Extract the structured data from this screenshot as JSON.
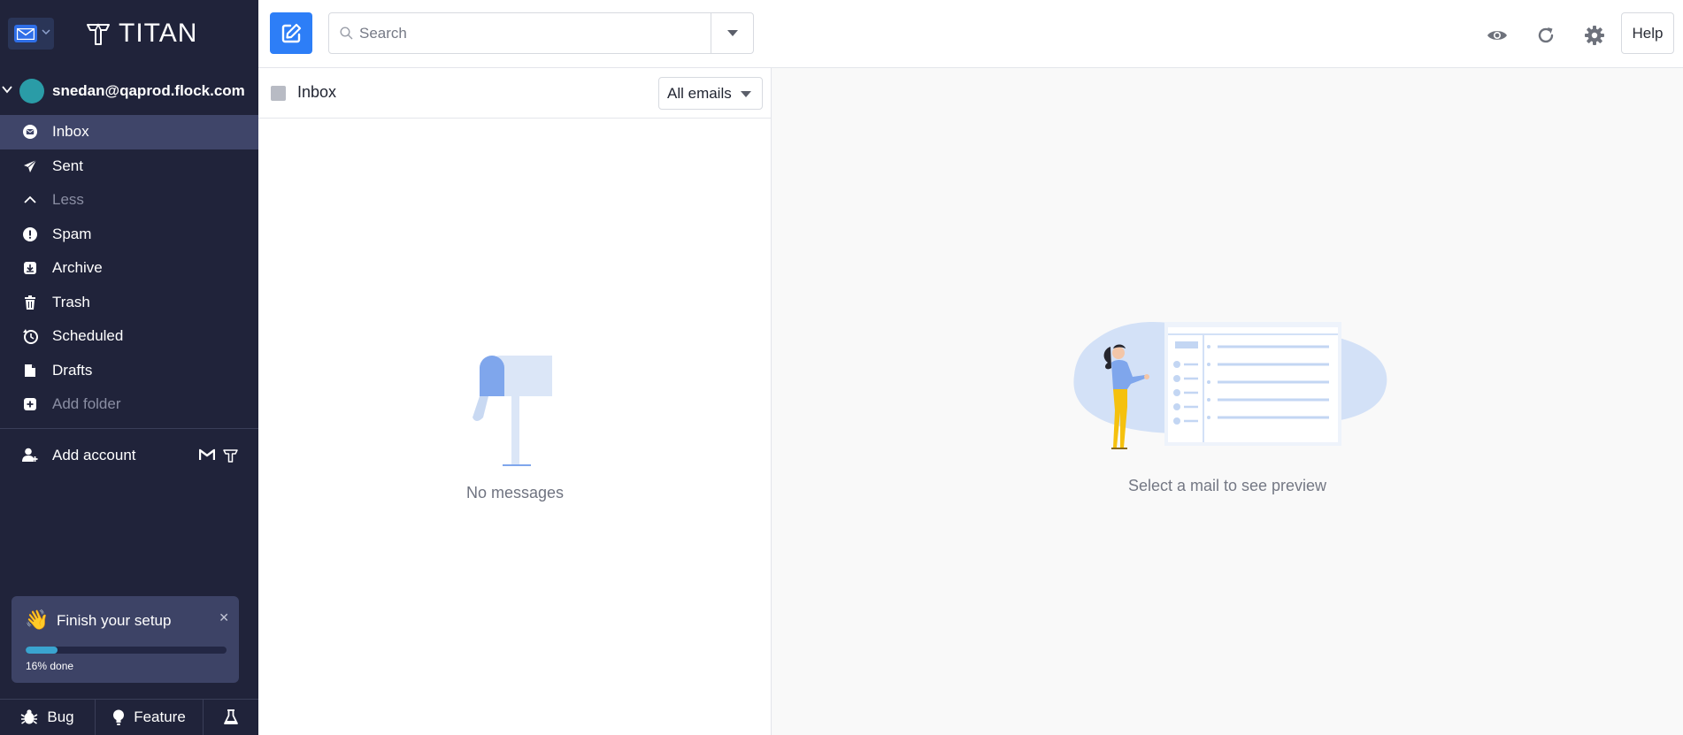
{
  "brand": {
    "logo_text": "TITAN"
  },
  "account": {
    "email": "snedan@qaprod.flock.com"
  },
  "nav": {
    "items": [
      {
        "label": "Inbox",
        "icon": "inbox-icon",
        "active": true
      },
      {
        "label": "Sent",
        "icon": "send-icon"
      },
      {
        "label": "Less",
        "icon": "chevron-up-icon",
        "muted": true
      },
      {
        "label": "Spam",
        "icon": "alert-icon"
      },
      {
        "label": "Archive",
        "icon": "archive-icon"
      },
      {
        "label": "Trash",
        "icon": "trash-icon"
      },
      {
        "label": "Scheduled",
        "icon": "scheduled-icon"
      },
      {
        "label": "Drafts",
        "icon": "drafts-icon"
      },
      {
        "label": "Add folder",
        "icon": "add-folder-icon",
        "muted": true
      }
    ]
  },
  "add_account": {
    "label": "Add account"
  },
  "setup": {
    "title": "Finish your setup",
    "progress_label": "16% done",
    "progress_fraction": 0.16
  },
  "bottom": {
    "bug_label": "Bug",
    "feature_label": "Feature"
  },
  "toolbar": {
    "search_placeholder": "Search",
    "help_label": "Help"
  },
  "list": {
    "folder_name": "Inbox",
    "filter_label": "All emails",
    "empty_label": "No messages"
  },
  "preview": {
    "empty_label": "Select a mail to see preview"
  },
  "colors": {
    "sidebar_bg": "#20233a",
    "active_item_bg": "#3f4569",
    "accent": "#2d7ef7",
    "progress": "#3aa4cf"
  }
}
